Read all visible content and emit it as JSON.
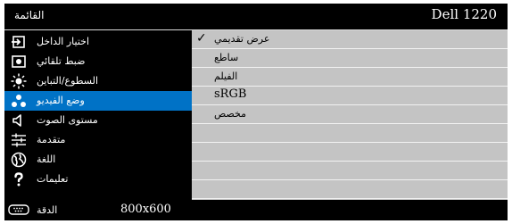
{
  "header": {
    "menu_title": "القائمة",
    "model": "Dell 1220"
  },
  "menu": {
    "items": [
      {
        "label": "اختيار الداخل",
        "icon": "input-select-icon"
      },
      {
        "label": "ضبط تلقائي",
        "icon": "auto-adjust-icon"
      },
      {
        "label": "السطوع/التباين",
        "icon": "brightness-contrast-icon"
      },
      {
        "label": "وضع الفيديو",
        "icon": "video-mode-icon",
        "selected": true
      },
      {
        "label": "مستوى الصوت",
        "icon": "speaker-volume-icon"
      },
      {
        "label": "متقدمة",
        "icon": "advanced-settings-icon"
      },
      {
        "label": "اللغة",
        "icon": "language-globe-icon"
      },
      {
        "label": "تعليمات",
        "icon": "help-question-icon"
      }
    ]
  },
  "video_mode": {
    "options": [
      "عرض تقديمي",
      "ساطع",
      "الفيلم",
      "sRGB",
      "مخصص"
    ],
    "selected": "عرض تقديمي",
    "check_mark": "✓"
  },
  "status": {
    "label": "الدقة",
    "value": "800x600",
    "icon": "resolution-connector-icon"
  },
  "colors": {
    "background": "#000000",
    "highlight": "#0072c6",
    "panel": "#c4c4c4",
    "separator": "#f2f2f2"
  }
}
